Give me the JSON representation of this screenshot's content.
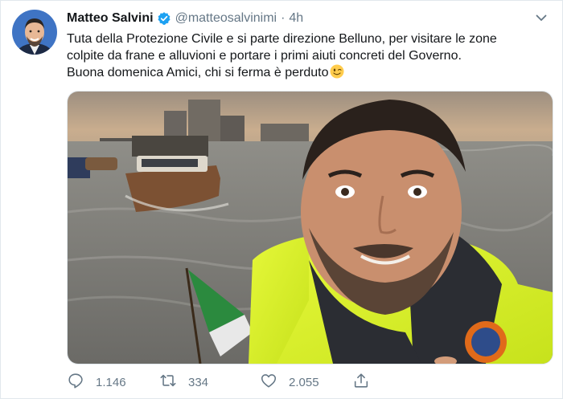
{
  "tweet": {
    "author_name": "Matteo Salvini",
    "handle": "@matteosalvinimi",
    "separator": "·",
    "time": "4h",
    "text_lines": [
      "Tuta della Protezione Civile e si parte direzione Belluno, per visitare le zone",
      "colpite da frane e alluvioni e portare i primi aiuti concreti del Governo.",
      "Buona domenica Amici, chi si ferma è perduto"
    ],
    "emoji": "winking-face-emoji",
    "replies": "1.146",
    "retweets": "334",
    "likes": "2.055"
  },
  "icons": {
    "verified": "verified-badge-icon",
    "caret": "chevron-down-icon",
    "reply": "reply-icon",
    "retweet": "retweet-icon",
    "like": "heart-icon",
    "share": "share-icon"
  },
  "colors": {
    "text": "#14171a",
    "secondary": "#657786",
    "verified": "#1da1f2",
    "border": "#e1e8ed",
    "hivis_yellow": "#d8f32a"
  }
}
